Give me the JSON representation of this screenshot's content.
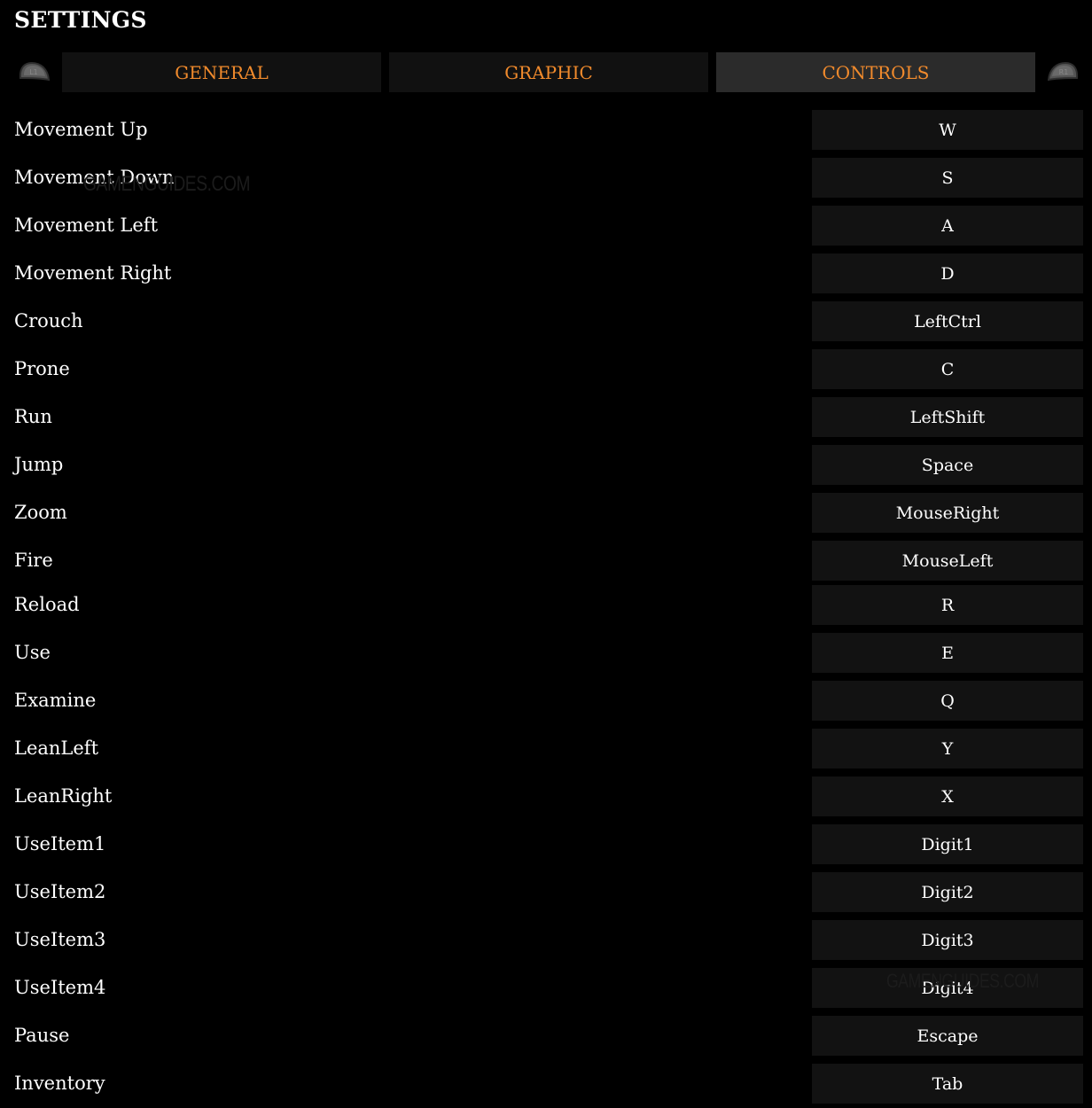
{
  "header": {
    "title": "SETTINGS"
  },
  "bumpers": {
    "left": "L1",
    "right": "R1"
  },
  "tabs": [
    {
      "label": "GENERAL",
      "active": false
    },
    {
      "label": "GRAPHIC",
      "active": false
    },
    {
      "label": "CONTROLS",
      "active": true
    }
  ],
  "colors": {
    "accent": "#f08a2c",
    "tab_bg": "#111111",
    "tab_active_bg": "#2b2b2b",
    "key_bg": "#121212"
  },
  "watermark": "GAMENGUIDES.COM",
  "bindings": [
    {
      "action": "Movement Up",
      "key": "W"
    },
    {
      "action": "Movement Down",
      "key": "S"
    },
    {
      "action": "Movement Left",
      "key": "A"
    },
    {
      "action": "Movement Right",
      "key": "D"
    },
    {
      "action": "Crouch",
      "key": "LeftCtrl"
    },
    {
      "action": "Prone",
      "key": "C"
    },
    {
      "action": "Run",
      "key": "LeftShift"
    },
    {
      "action": "Jump",
      "key": "Space"
    },
    {
      "action": "Zoom",
      "key": "MouseRight"
    },
    {
      "action": "Fire",
      "key": "MouseLeft"
    },
    {
      "action": "Reload",
      "key": "R"
    },
    {
      "action": "Use",
      "key": "E"
    },
    {
      "action": "Examine",
      "key": "Q"
    },
    {
      "action": "LeanLeft",
      "key": "Y"
    },
    {
      "action": "LeanRight",
      "key": "X"
    },
    {
      "action": "UseItem1",
      "key": "Digit1"
    },
    {
      "action": "UseItem2",
      "key": "Digit2"
    },
    {
      "action": "UseItem3",
      "key": "Digit3"
    },
    {
      "action": "UseItem4",
      "key": "Digit4"
    },
    {
      "action": "Pause",
      "key": "Escape"
    },
    {
      "action": "Inventory",
      "key": "Tab"
    }
  ]
}
